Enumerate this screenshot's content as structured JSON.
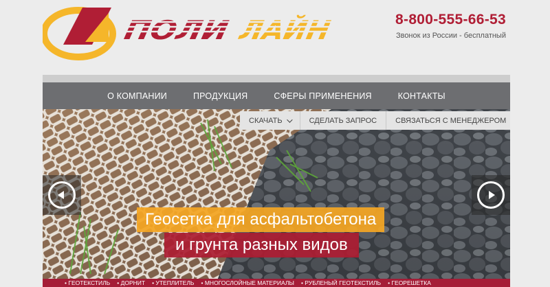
{
  "brand": {
    "logo_text_part1": "ПОЛИ",
    "logo_text_part2": "ЛАЙН",
    "red": "#b01e35",
    "yellow": "#f5b62a"
  },
  "header": {
    "phone": "8-800-555-66-53",
    "phone_note": "Звонок из России - бесплатный"
  },
  "nav": {
    "items": [
      "О КОМПАНИИ",
      "ПРОДУКЦИЯ",
      "СФЕРЫ ПРИМЕНЕНИЯ",
      "КОНТАКТЫ"
    ]
  },
  "subnav": {
    "download": "СКАЧАТЬ",
    "request": "СДЕЛАТЬ ЗАПРОС",
    "manager": "СВЯЗАТЬСЯ С МЕНЕДЖЕРОМ"
  },
  "slider": {
    "caption_line1": "Геосетка для асфальтобетона",
    "caption_line2": "и грунта разных видов",
    "prev_icon": "chevron-left-icon",
    "next_icon": "chevron-right-icon"
  },
  "products_bar": {
    "items": [
      "• ГЕОТЕКСТИЛЬ",
      "• ДОРНИТ",
      "• УТЕПЛИТЕЛЬ",
      "• МНОГОСЛОЙНЫЕ МАТЕРИАЛЫ",
      "• РУБЛЕНЫЙ ГЕОТЕКСТИЛЬ",
      "• ГЕОРЕШЕТКА"
    ]
  }
}
